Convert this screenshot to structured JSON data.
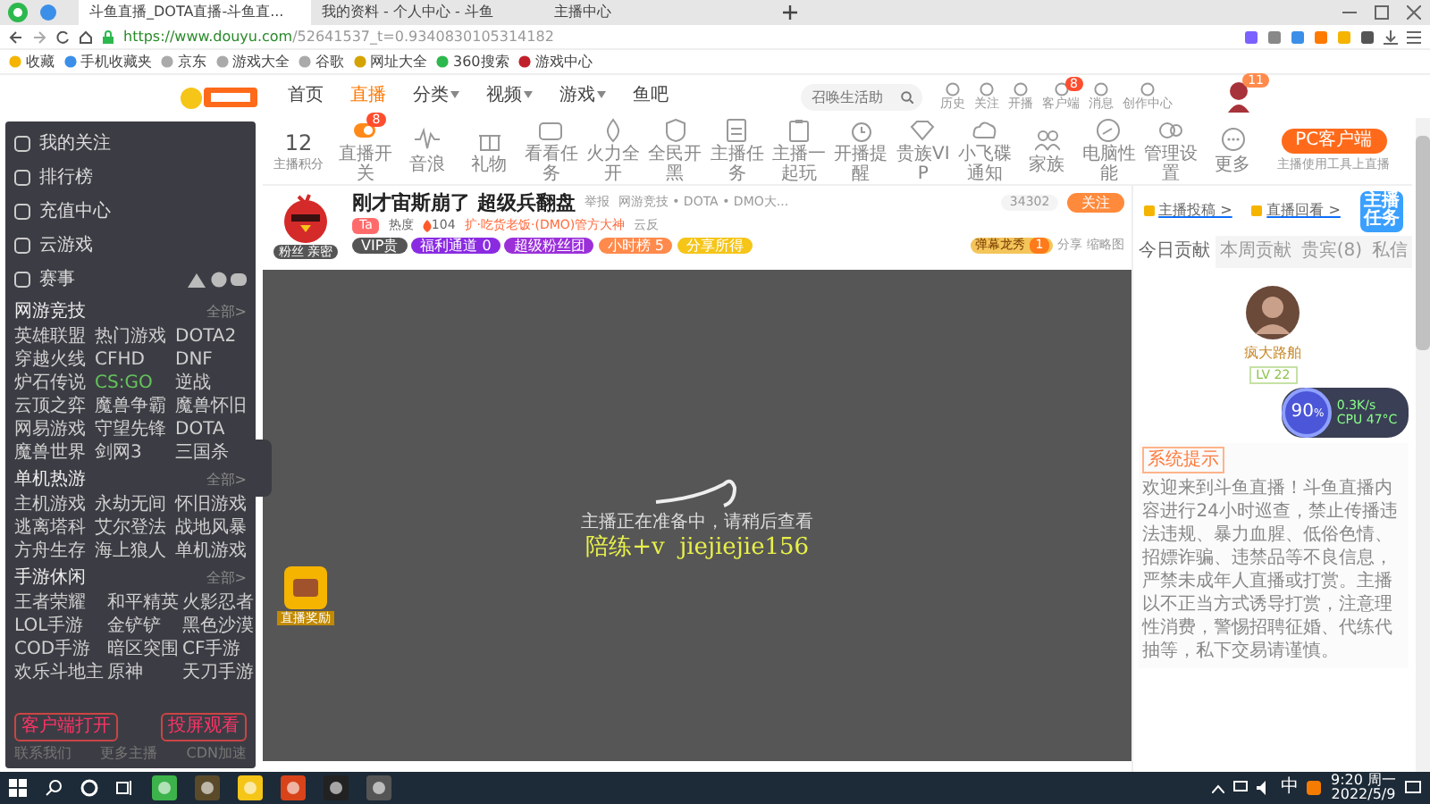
{
  "browser": {
    "tabs": [
      {
        "title": "斗鱼直播_DOTA直播-斗鱼直...",
        "selected": true
      },
      {
        "title": "我的资料 - 个人中心 - 斗鱼",
        "selected": false
      },
      {
        "title": "主播中心",
        "selected": false
      }
    ],
    "url_host": "https://www.douyu.com",
    "url_path": "/52641537_t=0.9340830105314182",
    "bookmarks": [
      "收藏",
      "手机收藏夹",
      "京东",
      "游戏大全",
      "谷歌",
      "网址大全",
      "360搜索",
      "游戏中心"
    ]
  },
  "site_header": {
    "nav": [
      {
        "label": "首页",
        "selected": false,
        "dropdown": false
      },
      {
        "label": "直播",
        "selected": true,
        "dropdown": false
      },
      {
        "label": "分类",
        "selected": false,
        "dropdown": true
      },
      {
        "label": "视频",
        "selected": false,
        "dropdown": true
      },
      {
        "label": "游戏",
        "selected": false,
        "dropdown": true
      },
      {
        "label": "鱼吧",
        "selected": false,
        "dropdown": false
      }
    ],
    "search": {
      "placeholder": "召唤生活助"
    },
    "links": [
      {
        "label": "历史"
      },
      {
        "label": "关注"
      },
      {
        "label": "开播"
      },
      {
        "label": "客户端",
        "badge": "8"
      },
      {
        "label": "消息"
      },
      {
        "label": "创作中心"
      }
    ],
    "avatar_badge": "11"
  },
  "sidebar": {
    "menu": [
      "我的关注",
      "排行榜",
      "充值中心",
      "云游戏",
      "赛事"
    ],
    "sections": [
      {
        "title": "网游竞技",
        "more": "全部>",
        "games": [
          {
            "label": "英雄联盟",
            "selected": false
          },
          {
            "label": "热门游戏",
            "selected": false
          },
          {
            "label": "DOTA2",
            "selected": false
          },
          {
            "label": "穿越火线",
            "selected": false
          },
          {
            "label": "CFHD",
            "selected": false
          },
          {
            "label": "DNF",
            "selected": false
          },
          {
            "label": "炉石传说",
            "selected": false
          },
          {
            "label": "CS:GO",
            "selected": true
          },
          {
            "label": "逆战",
            "selected": false
          },
          {
            "label": "云顶之弈",
            "selected": false
          },
          {
            "label": "魔兽争霸",
            "selected": false
          },
          {
            "label": "魔兽怀旧",
            "selected": false
          },
          {
            "label": "网易游戏",
            "selected": false
          },
          {
            "label": "守望先锋",
            "selected": false
          },
          {
            "label": "DOTA",
            "selected": false
          },
          {
            "label": "魔兽世界",
            "selected": false
          },
          {
            "label": "剑网3",
            "selected": false
          },
          {
            "label": "三国杀",
            "selected": false
          }
        ]
      },
      {
        "title": "单机热游",
        "more": "全部>",
        "games": [
          {
            "label": "主机游戏",
            "selected": false
          },
          {
            "label": "永劫无间",
            "selected": false
          },
          {
            "label": "怀旧游戏",
            "selected": false
          },
          {
            "label": "逃离塔科",
            "selected": false
          },
          {
            "label": "艾尔登法",
            "selected": false
          },
          {
            "label": "战地风暴",
            "selected": false
          },
          {
            "label": "方舟生存",
            "selected": false
          },
          {
            "label": "海上狼人",
            "selected": false
          },
          {
            "label": "单机游戏",
            "selected": false
          }
        ]
      },
      {
        "title": "手游休闲",
        "more": "全部>",
        "games": [
          {
            "label": "王者荣耀",
            "selected": false
          },
          {
            "label": "和平精英",
            "selected": false
          },
          {
            "label": "火影忍者",
            "selected": false
          },
          {
            "label": "LOL手游",
            "selected": false
          },
          {
            "label": "金铲铲",
            "selected": false
          },
          {
            "label": "黑色沙漠",
            "selected": false
          },
          {
            "label": "COD手游",
            "selected": false
          },
          {
            "label": "暗区突围",
            "selected": false
          },
          {
            "label": "CF手游",
            "selected": false
          },
          {
            "label": "欢乐斗地主",
            "selected": false
          },
          {
            "label": "原神",
            "selected": false
          },
          {
            "label": "天刀手游",
            "selected": false
          }
        ]
      }
    ],
    "buttons": [
      "客户端打开",
      "投屏观看"
    ],
    "footer": [
      "联系我们",
      "更多主播",
      "CDN加速"
    ]
  },
  "toolbar": {
    "score": "12",
    "score_label": "主播积分",
    "items": [
      {
        "label": "直播开关",
        "badge": "8"
      },
      {
        "label": "音浪"
      },
      {
        "label": "礼物"
      },
      {
        "label": "看看任务"
      },
      {
        "label": "火力全开"
      },
      {
        "label": "全民开黑"
      },
      {
        "label": "主播任务"
      },
      {
        "label": "主播一起玩"
      },
      {
        "label": "开播提醒"
      },
      {
        "label": "贵族VIP"
      },
      {
        "label": "小飞碟通知"
      },
      {
        "label": "家族"
      },
      {
        "label": "电脑性能"
      },
      {
        "label": "管理设置"
      },
      {
        "label": "更多"
      }
    ],
    "pc_button": "PC客户端",
    "pc_caption": "主播使用工具上直播"
  },
  "room": {
    "title": "刚才宙斯崩了 超级兵翻盘",
    "report": "举报",
    "category": "网游竞技 • DOTA • DMO大...",
    "tag": "Ta",
    "heat_label": "热度",
    "heat": "104",
    "honor": "扩·吃货老饭·(DMO)管方大神",
    "location": "云反",
    "avatar_caption": "粉丝 亲密",
    "badges": [
      {
        "label": "VIP贵",
        "color": "#555555"
      },
      {
        "label": "福利通道 0",
        "color": "#8a2be2"
      },
      {
        "label": "超级粉丝团",
        "color": "#9b30d9"
      },
      {
        "label": "小时榜 5",
        "color": "#ff8a4c"
      },
      {
        "label": "分享所得",
        "color": "#f5c518"
      }
    ],
    "followers": "34302",
    "follow": "关注",
    "gift_label": "弹幕龙秀",
    "gift_count": "1",
    "share": "分享",
    "thumb": "缩略图"
  },
  "video": {
    "message": "主播正在准备中，请稍后查看",
    "overlay": "陪练+v  jiejiejie156",
    "reward": "直播奖励"
  },
  "panel": {
    "links": [
      "主播投稿 >",
      "直播回看 >"
    ],
    "tabs": [
      {
        "label": "今日贡献",
        "selected": true
      },
      {
        "label": "本周贡献",
        "selected": false
      },
      {
        "label": "贵宾(8)",
        "selected": false
      },
      {
        "label": "私信",
        "selected": false
      }
    ],
    "name": "疯大路舶",
    "level": "LV 22",
    "notice_tag": "系统提示",
    "notice": "欢迎来到斗鱼直播！斗鱼直播内容进行24小时巡查，禁止传播违法违规、暴力血腥、低俗色情、招嫖诈骗、违禁品等不良信息，严禁未成年人直播或打赏。主播以不正当方式诱导打赏，注意理性消费，警惕招聘征婚、代练代抽等，私下交易请谨慎。",
    "task": "主播任务",
    "meter": "90",
    "meter_unit": "%",
    "speed": "0.3K/s",
    "cpu": "CPU 47°C"
  },
  "taskbar": {
    "ime": "中",
    "time": "9:20 周一",
    "date": "2022/5/9"
  }
}
